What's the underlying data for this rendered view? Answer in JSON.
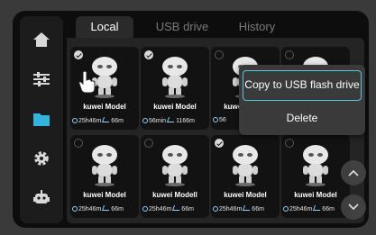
{
  "tabs": [
    {
      "label": "Local"
    },
    {
      "label": "USB drive"
    },
    {
      "label": "History"
    }
  ],
  "sidebar": {
    "items": [
      {
        "icon": "home-icon"
      },
      {
        "icon": "sliders-icon"
      },
      {
        "icon": "folder-icon"
      },
      {
        "icon": "gear-icon"
      },
      {
        "icon": "robot-icon"
      }
    ],
    "active_color": "#2fb5e0"
  },
  "files": [
    {
      "name": "kuwei Model",
      "time": "25h46m",
      "length": "66m",
      "checked": true
    },
    {
      "name": "kuwei Model",
      "time": "56min",
      "length": "1166m",
      "checked": true
    },
    {
      "name": "kuwei Model",
      "time": "56",
      "length": "",
      "checked": false
    },
    {
      "name": "",
      "time": "",
      "length": "",
      "checked": false
    },
    {
      "name": "kuwei Model",
      "time": "25h46m",
      "length": "66m",
      "checked": false
    },
    {
      "name": "kuwei Modell",
      "time": "25h46m",
      "length": "66m",
      "checked": false
    },
    {
      "name": "kuwei Model",
      "time": "25h46m",
      "length": "66m",
      "checked": true
    },
    {
      "name": "kuwei Model",
      "time": "25h46m",
      "length": "66m",
      "checked": false
    }
  ],
  "context_menu": {
    "copy_label": "Copy to USB flash drive",
    "delete_label": "Delete"
  },
  "accent_color": "#54c7e6"
}
